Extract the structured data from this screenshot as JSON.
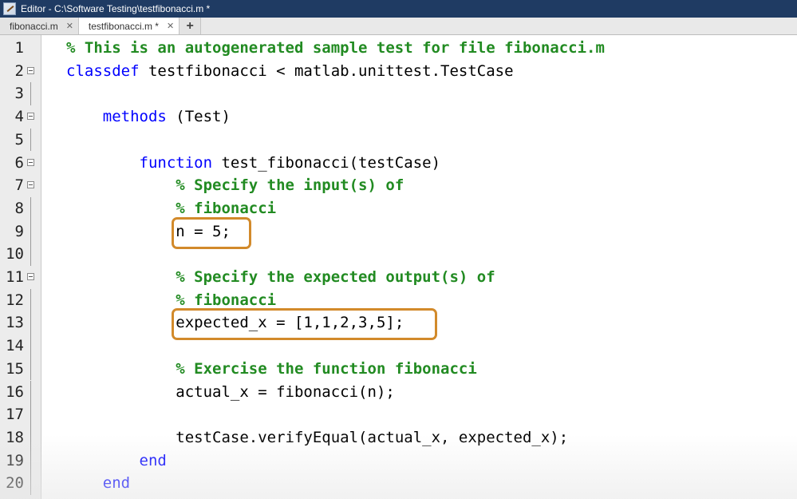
{
  "window": {
    "title": "Editor - C:\\Software Testing\\testfibonacci.m *"
  },
  "tabs": [
    {
      "label": "fibonacci.m",
      "close": "✕",
      "active": false
    },
    {
      "label": "testfibonacci.m *",
      "close": "✕",
      "active": true
    }
  ],
  "add_tab_label": "+",
  "editor": {
    "lines": [
      {
        "num": "1",
        "fold": "none",
        "indent": "",
        "segments": [
          {
            "cls": "cm",
            "text": "% This is an autogenerated sample test for file fibonacci.m"
          }
        ]
      },
      {
        "num": "2",
        "fold": "box",
        "indent": "",
        "segments": [
          {
            "cls": "kw",
            "text": "classdef"
          },
          {
            "cls": "",
            "text": " testfibonacci < matlab.unittest.TestCase"
          }
        ]
      },
      {
        "num": "3",
        "fold": "line",
        "indent": "",
        "segments": []
      },
      {
        "num": "4",
        "fold": "box",
        "indent": "    ",
        "segments": [
          {
            "cls": "kw",
            "text": "methods"
          },
          {
            "cls": "",
            "text": " (Test)"
          }
        ]
      },
      {
        "num": "5",
        "fold": "line",
        "indent": "",
        "segments": []
      },
      {
        "num": "6",
        "fold": "box",
        "indent": "        ",
        "segments": [
          {
            "cls": "kw",
            "text": "function"
          },
          {
            "cls": "",
            "text": " test_fibonacci(testCase)"
          }
        ]
      },
      {
        "num": "7",
        "fold": "box",
        "indent": "            ",
        "segments": [
          {
            "cls": "cm",
            "text": "% Specify the input(s) of"
          }
        ]
      },
      {
        "num": "8",
        "fold": "line",
        "indent": "            ",
        "segments": [
          {
            "cls": "cm",
            "text": "% fibonacci"
          }
        ]
      },
      {
        "num": "9",
        "fold": "line",
        "indent": "            ",
        "segments": [
          {
            "cls": "",
            "text": "n = 5;"
          }
        ]
      },
      {
        "num": "10",
        "fold": "line",
        "indent": "",
        "segments": []
      },
      {
        "num": "11",
        "fold": "box",
        "indent": "            ",
        "segments": [
          {
            "cls": "cm",
            "text": "% Specify the expected output(s) of"
          }
        ]
      },
      {
        "num": "12",
        "fold": "line",
        "indent": "            ",
        "segments": [
          {
            "cls": "cm",
            "text": "% fibonacci"
          }
        ]
      },
      {
        "num": "13",
        "fold": "line",
        "indent": "            ",
        "segments": [
          {
            "cls": "",
            "text": "expected_x = [1,1,2,3,5];"
          }
        ]
      },
      {
        "num": "14",
        "fold": "line",
        "indent": "",
        "segments": []
      },
      {
        "num": "15",
        "fold": "line",
        "indent": "            ",
        "segments": [
          {
            "cls": "cm",
            "text": "% Exercise the function fibonacci"
          }
        ]
      },
      {
        "num": "16",
        "fold": "line",
        "indent": "            ",
        "segments": [
          {
            "cls": "",
            "text": "actual_x = fibonacci(n);"
          }
        ]
      },
      {
        "num": "17",
        "fold": "line",
        "indent": "",
        "segments": []
      },
      {
        "num": "18",
        "fold": "line",
        "indent": "            ",
        "segments": [
          {
            "cls": "",
            "text": "testCase.verifyEqual(actual_x, expected_x);"
          }
        ]
      },
      {
        "num": "19",
        "fold": "line",
        "indent": "        ",
        "segments": [
          {
            "cls": "kw",
            "text": "end"
          }
        ]
      },
      {
        "num": "20",
        "fold": "line",
        "indent": "    ",
        "segments": [
          {
            "cls": "kw",
            "text": "end"
          }
        ]
      }
    ]
  },
  "colors": {
    "keyword": "#0000ff",
    "comment": "#228b22",
    "highlight_box": "#d28a2b",
    "titlebar": "#1f3b63"
  }
}
